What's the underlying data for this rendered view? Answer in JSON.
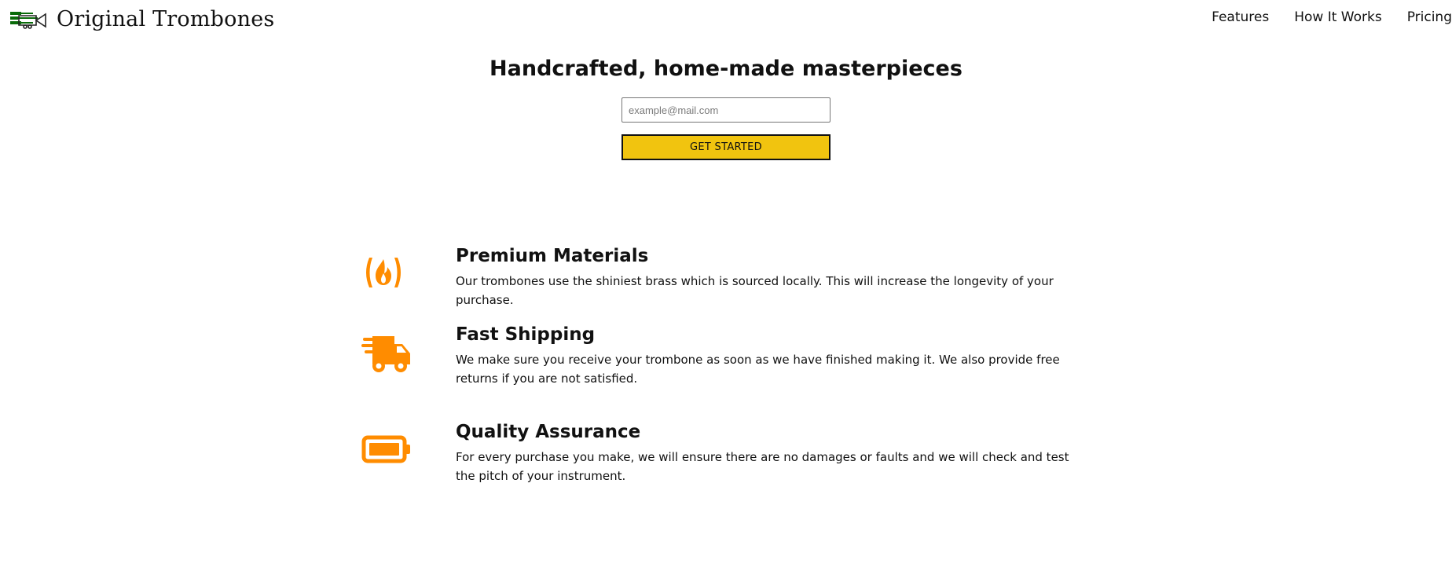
{
  "header": {
    "brand": "Original Trombones",
    "logo_icon": "trombone-icon",
    "nav": [
      {
        "label": "Features"
      },
      {
        "label": "How It Works"
      },
      {
        "label": "Pricing"
      }
    ]
  },
  "hero": {
    "title": "Handcrafted, home-made masterpieces",
    "email_placeholder": "example@mail.com",
    "cta_label": "GET STARTED"
  },
  "features": [
    {
      "icon": "fire-icon",
      "title": "Premium Materials",
      "description": "Our trombones use the shiniest brass which is sourced locally. This will increase the longevity of your purchase."
    },
    {
      "icon": "truck-icon",
      "title": "Fast Shipping",
      "description": "We make sure you receive your trombone as soon as we have finished making it. We also provide free returns if you are not satisfied."
    },
    {
      "icon": "battery-icon",
      "title": "Quality Assurance",
      "description": "For every purchase you make, we will ensure there are no damages or faults and we will check and test the pitch of your instrument."
    }
  ],
  "colors": {
    "accent": "#ff8c00",
    "cta": "#f1c40f",
    "logo": "#0a6b0a"
  }
}
